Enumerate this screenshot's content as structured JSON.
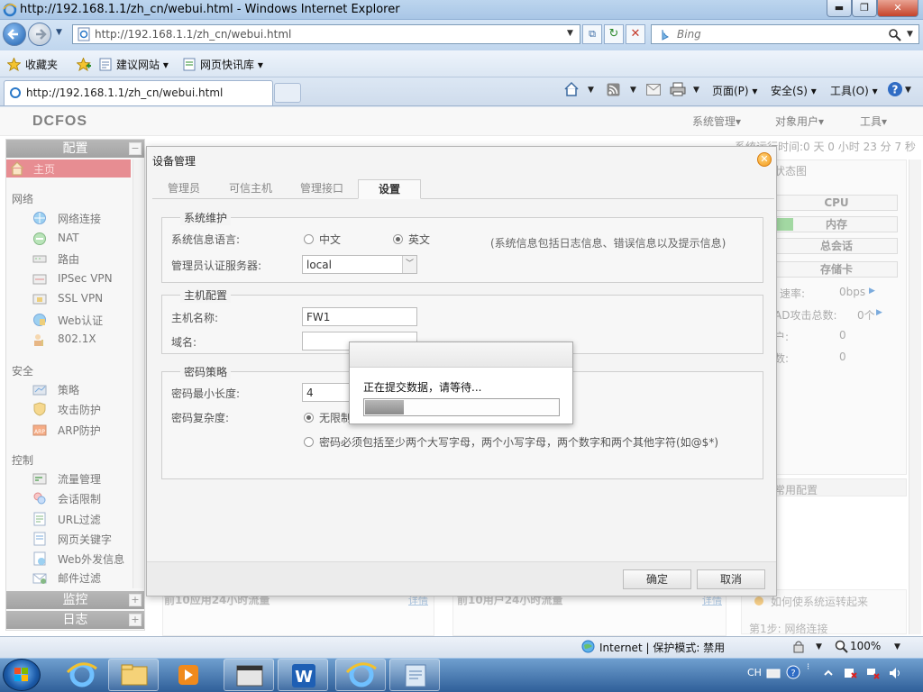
{
  "browser": {
    "window_title": "http://192.168.1.1/zh_cn/webui.html - Windows Internet Explorer",
    "address": "http://192.168.1.1/zh_cn/webui.html",
    "search_placeholder": "Bing",
    "favorites": [
      {
        "label": "收藏夹"
      },
      {
        "label": "建议网站 ▾"
      },
      {
        "label": "网页快讯库 ▾"
      }
    ],
    "tab_title": "http://192.168.1.1/zh_cn/webui.html",
    "commands": [
      {
        "label": "页面(P) ▾"
      },
      {
        "label": "安全(S) ▾"
      },
      {
        "label": "工具(O) ▾"
      }
    ],
    "status": {
      "zone": "Internet | 保护模式: 禁用",
      "zoom": "100%"
    }
  },
  "app": {
    "logo": "DCFOS",
    "top_menu": [
      "系统管理▾",
      "对象用户▾",
      "工具▾"
    ],
    "sysinfo": "系统运行时间:0 天 0 小时 23 分 7 秒",
    "sidebar": {
      "config_header": "配置",
      "home": "主页",
      "categories": [
        {
          "title": "网络",
          "items": [
            "网络连接",
            "NAT",
            "路由",
            "IPSec VPN",
            "SSL VPN",
            "Web认证",
            "802.1X"
          ]
        },
        {
          "title": "安全",
          "items": [
            "策略",
            "攻击防护",
            "ARP防护"
          ]
        },
        {
          "title": "控制",
          "items": [
            "流量管理",
            "会话限制",
            "URL过滤",
            "网页关键字",
            "Web外发信息",
            "邮件过滤"
          ]
        }
      ],
      "monitor_header": "监控",
      "log_header": "日志"
    },
    "right_panel": {
      "title": "状态图",
      "buttons": [
        "CPU",
        "内存",
        "总会话",
        "存储卡"
      ],
      "stats": [
        {
          "label": "速率:",
          "value": "0bps"
        },
        {
          "label": "AD攻击总数:",
          "value": "0个"
        },
        {
          "label": "户:",
          "value": "0"
        },
        {
          "label": "数:",
          "value": "0"
        }
      ],
      "common_config": "常用配置",
      "help_item": "如何使系统运转起来",
      "help_step": "第1步: 网络连接"
    },
    "bottom_panels": [
      {
        "title": "前10应用24小时流量",
        "link": "详情"
      },
      {
        "title": "前10用户24小时流量",
        "link": "详情"
      }
    ]
  },
  "modal": {
    "title": "设备管理",
    "tabs": [
      {
        "label": "管理员",
        "active": false
      },
      {
        "label": "可信主机",
        "active": false
      },
      {
        "label": "管理接口",
        "active": false
      },
      {
        "label": "设置",
        "active": true
      }
    ],
    "maintenance": {
      "legend": "系统维护",
      "lang_label": "系统信息语言:",
      "lang_options": [
        {
          "label": "中文",
          "selected": false
        },
        {
          "label": "英文",
          "selected": true
        }
      ],
      "lang_note": "(系统信息包括日志信息、错误信息以及提示信息)",
      "auth_label": "管理员认证服务器:",
      "auth_value": "local"
    },
    "host": {
      "legend": "主机配置",
      "hostname_label": "主机名称:",
      "hostname_value": "FW1",
      "domain_label": "域名:",
      "domain_value": ""
    },
    "password": {
      "legend": "密码策略",
      "minlen_label": "密码最小长度:",
      "minlen_value": "4",
      "complexity_label": "密码复杂度:",
      "complexity_options": [
        {
          "label": "无限制",
          "selected": true
        },
        {
          "label": "密码必须包括至少两个大写字母，两个小写字母，两个数字和两个其他字符(如@$*)",
          "selected": false
        }
      ]
    },
    "ok_label": "确定",
    "cancel_label": "取消"
  },
  "progress": {
    "message": "正在提交数据，请等待...",
    "percent": 20
  },
  "taskbar": {
    "language": "CH"
  }
}
